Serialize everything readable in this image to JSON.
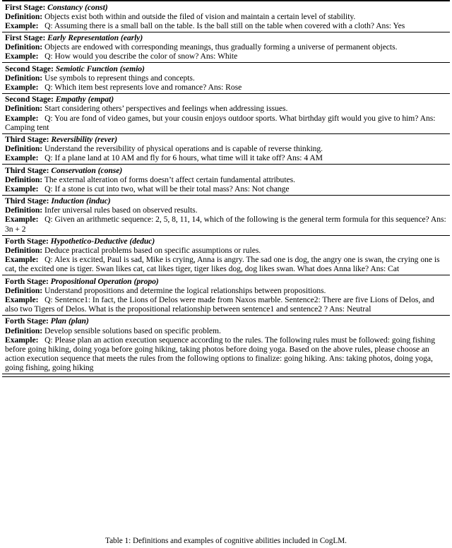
{
  "document": {
    "type": "academic-paper-table",
    "labels": {
      "stage_separator": ":",
      "definition": "Definition:",
      "example": "Example:"
    }
  },
  "table": {
    "rows": [
      {
        "stage": "First Stage:",
        "name": "Constancy",
        "abbr": "(const)",
        "definition": "Objects exist both within and outside the filed of vision and maintain a certain level of stability.",
        "example": "Q: Assuming there is a small ball on the table. Is the ball still on the table when covered with a cloth? Ans: Yes"
      },
      {
        "stage": "First Stage:",
        "name": "Early Representation",
        "abbr": "(early)",
        "definition": "Objects are endowed with corresponding meanings, thus gradually forming a universe of permanent objects.",
        "example": "Q: How would you describe the color of snow? Ans: White"
      },
      {
        "stage": "Second Stage:",
        "name": "Semiotic Function",
        "abbr": "(semio)",
        "definition": "Use symbols to represent things and concepts.",
        "example": "Q: Which item best represents love and romance? Ans: Rose"
      },
      {
        "stage": "Second Stage:",
        "name": "Empathy",
        "abbr": "(empat)",
        "definition": "Start considering others’ perspectives and feelings when addressing issues.",
        "example": "Q: You are fond of video games, but your cousin enjoys outdoor sports. What birthday gift would you give to him? Ans: Camping tent"
      },
      {
        "stage": "Third Stage:",
        "name": "Reversibility",
        "abbr": "(rever)",
        "definition": "Understand the reversibility of physical operations and is capable of reverse thinking.",
        "example": "Q: If a plane land at 10 AM and fly for 6 hours, what time will it take off? Ans: 4 AM"
      },
      {
        "stage": "Third Stage:",
        "name": "Conservation",
        "abbr": "(conse)",
        "definition": "The external alteration of forms doesn’t affect certain fundamental attributes.",
        "example": "Q: If a stone is cut into two, what will be their total mass? Ans: Not change"
      },
      {
        "stage": "Third Stage:",
        "name": "Induction",
        "abbr": "(induc)",
        "definition": "Infer universal rules based on observed results.",
        "example": "Q: Given an arithmetic sequence: 2, 5, 8, 11, 14, which of the following is the general term formula for this sequence? Ans: 3n + 2"
      },
      {
        "stage": "Forth Stage:",
        "name": "Hypothetico-Deductive",
        "abbr": "(deduc)",
        "definition": "Deduce practical problems based on specific assumptions or rules.",
        "example": "Q: Alex is excited, Paul is sad, Mike is crying, Anna is angry. The sad one is dog, the angry one is swan, the crying one is cat, the excited one is tiger. Swan likes cat, cat likes tiger, tiger likes dog, dog likes swan. What does Anna like? Ans: Cat"
      },
      {
        "stage": "Forth Stage:",
        "name": "Propositional Operation",
        "abbr": "(propo)",
        "definition": "Understand propositions and determine the logical relationships between propositions.",
        "example": "Q: Sentence1: In fact, the Lions of Delos were made from Naxos marble. Sentence2: There are five Lions of Delos, and also two Tigers of Delos. What is the propositional relationship between sentence1 and sentence2 ? Ans: Neutral"
      },
      {
        "stage": "Forth Stage:",
        "name": "Plan",
        "abbr": "(plan)",
        "definition": "Develop sensible solutions based on specific problem.",
        "example": "Q: Please plan an action execution sequence according to the rules. The following rules must be followed: going fishing before going hiking, doing yoga before going hiking, taking photos before doing yoga. Based on the above rules, please choose an action execution sequence that meets the rules from the following options to finalize: going hiking. Ans: taking photos, doing yoga, going fishing, going hiking"
      }
    ]
  },
  "caption": {
    "text": "Table 1: Definitions and examples of cognitive abilities included in CogLM."
  }
}
